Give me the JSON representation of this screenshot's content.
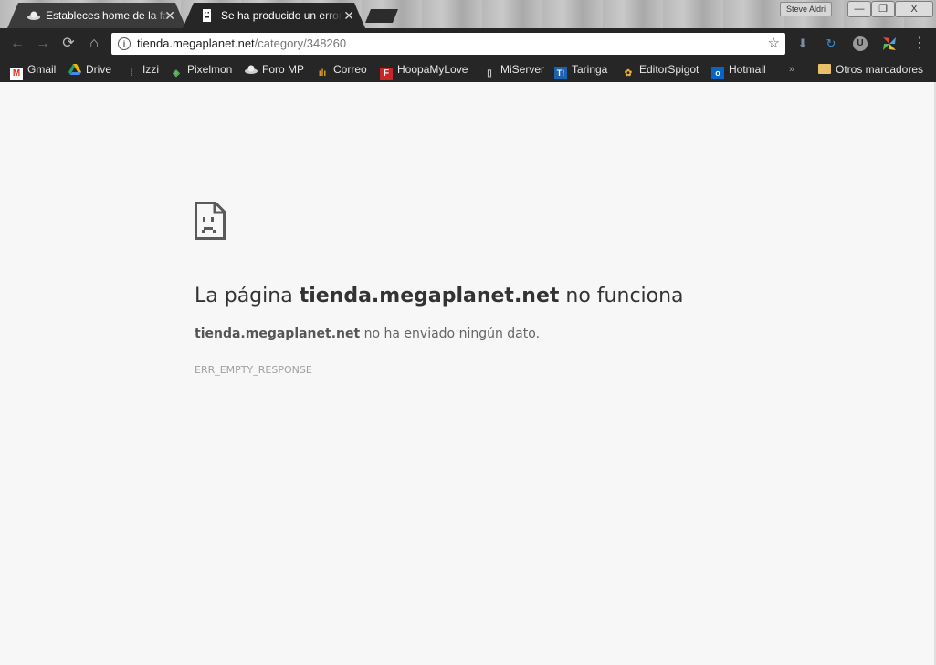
{
  "tabs": [
    {
      "title": "Estableces home de la fa",
      "active": false,
      "favicon": "ufo-icon"
    },
    {
      "title": "Se ha producido un error",
      "active": true,
      "favicon": "sad-document-icon"
    }
  ],
  "window": {
    "user_name": "Steve Aldri",
    "minimize": "—",
    "restore": "❐",
    "close": "X"
  },
  "toolbar": {
    "back": "←",
    "forward": "→",
    "reload": "⟳",
    "home": "⌂",
    "url_host": "tienda.megaplanet.net",
    "url_path": "/category/348260",
    "star": "☆",
    "extensions": [
      "download-icon",
      "sync-icon",
      "ublock-icon",
      "windmill-icon"
    ],
    "menu": "⋮"
  },
  "bookmarks": {
    "items": [
      {
        "label": "Gmail",
        "icon": "gmail-icon"
      },
      {
        "label": "Drive",
        "icon": "drive-icon"
      },
      {
        "label": "Izzi",
        "icon": "izzi-icon"
      },
      {
        "label": "Pixelmon",
        "icon": "pixelmon-icon"
      },
      {
        "label": "Foro MP",
        "icon": "ufo-icon"
      },
      {
        "label": "Correo",
        "icon": "correo-icon"
      },
      {
        "label": "HoopaMyLove",
        "icon": "f-icon"
      },
      {
        "label": "MiServer",
        "icon": "page-icon"
      },
      {
        "label": "Taringa",
        "icon": "taringa-icon"
      },
      {
        "label": "EditorSpigot",
        "icon": "spigot-icon"
      },
      {
        "label": "Hotmail",
        "icon": "outlook-icon"
      }
    ],
    "overflow": "»",
    "other": "Otros marcadores"
  },
  "error": {
    "heading_prefix": "La página ",
    "heading_host": "tienda.megaplanet.net",
    "heading_suffix": " no funciona",
    "detail_host": "tienda.megaplanet.net",
    "detail_text": " no ha enviado ningún dato.",
    "code": "ERR_EMPTY_RESPONSE"
  },
  "colors": {
    "toolbar": "#262626",
    "page_bg": "#f7f7f7",
    "heading": "#333333"
  }
}
